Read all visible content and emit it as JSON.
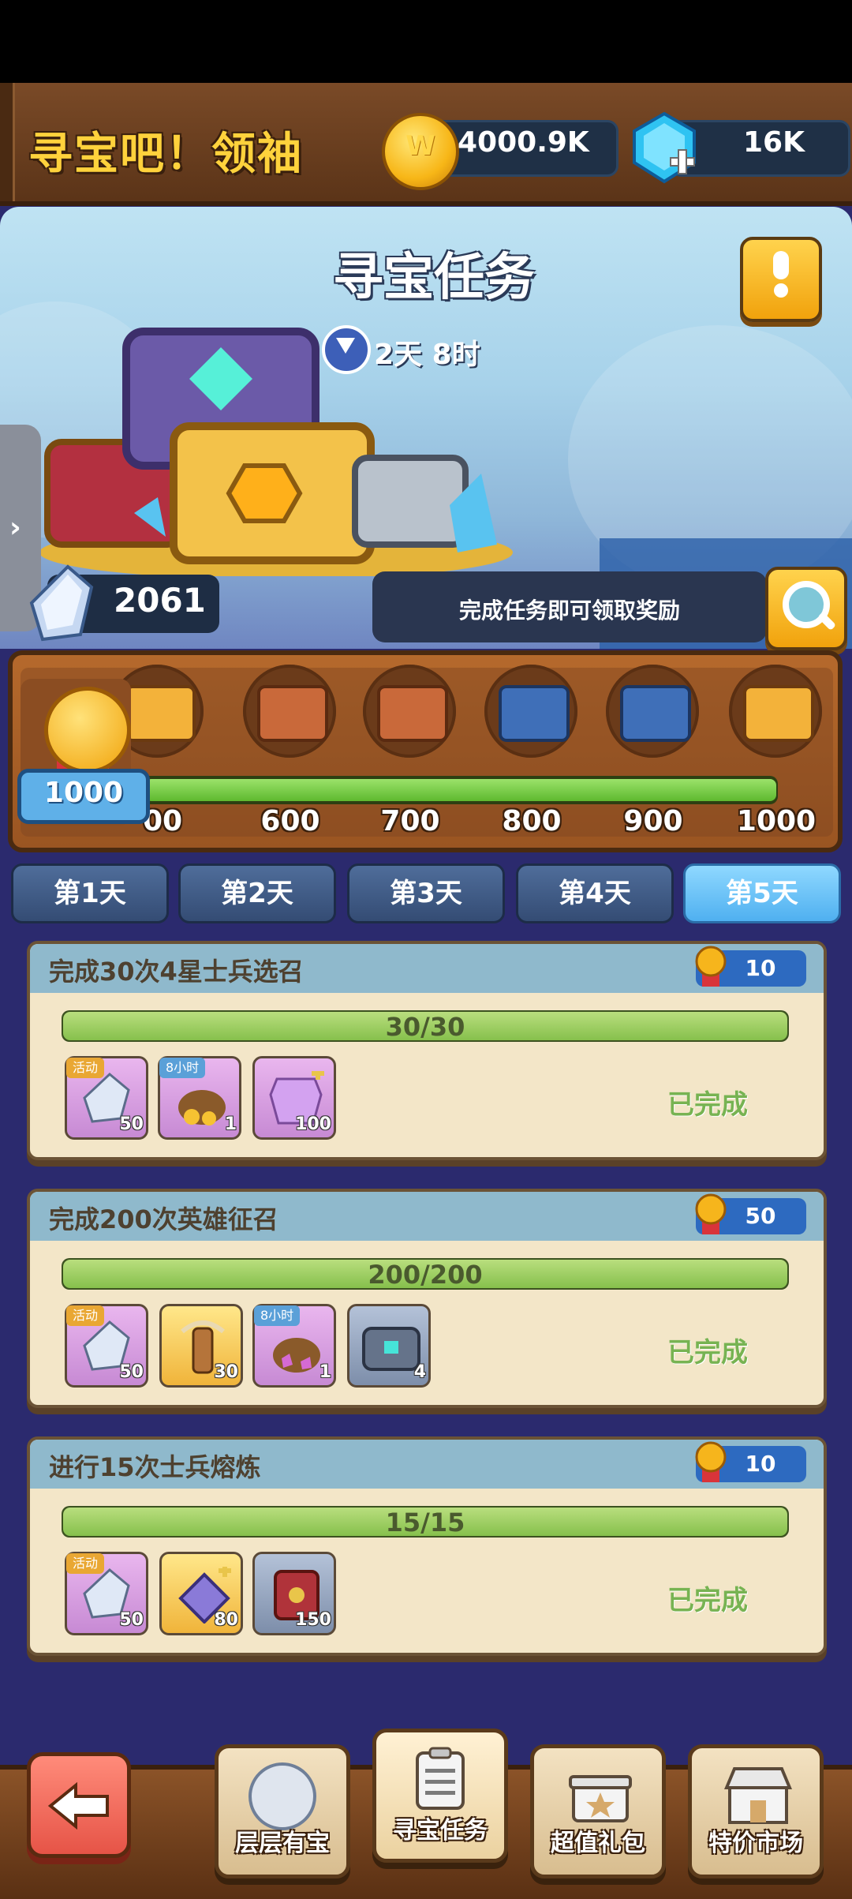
{
  "header": {
    "title": "寻宝吧！领袖",
    "coins": "4000.9K",
    "gems": "16K"
  },
  "hero": {
    "heading": "寻宝任务",
    "timer": "2天 8时",
    "crystal_count": "2061",
    "hint": "完成任务即可领取奖励"
  },
  "progress": {
    "current_score": "1000",
    "milestones": [
      "500",
      "600",
      "700",
      "800",
      "900",
      "1000"
    ],
    "visible_first_label": "00",
    "fill_fraction": 1.0
  },
  "days": {
    "tabs": [
      "第1天",
      "第2天",
      "第3天",
      "第4天",
      "第5天"
    ],
    "active_index": 4
  },
  "tasks": [
    {
      "title": "完成30次4星士兵选召",
      "points": "10",
      "progress_text": "30/30",
      "progress_fraction": 1.0,
      "status": "已完成",
      "rewards": [
        {
          "icon": "crystal-icon",
          "count": "50",
          "tag": "活动"
        },
        {
          "icon": "gold-sack-icon",
          "count": "1",
          "tag": "8小时"
        },
        {
          "icon": "armor-shard-icon",
          "count": "100",
          "tag": ""
        }
      ]
    },
    {
      "title": "完成200次英雄征召",
      "points": "50",
      "progress_text": "200/200",
      "progress_fraction": 1.0,
      "status": "已完成",
      "rewards": [
        {
          "icon": "crystal-icon",
          "count": "50",
          "tag": "活动"
        },
        {
          "icon": "totem-icon",
          "count": "30",
          "tag": ""
        },
        {
          "icon": "gem-sack-icon",
          "count": "1",
          "tag": "8小时"
        },
        {
          "icon": "chest-icon",
          "count": "4",
          "tag": ""
        }
      ]
    },
    {
      "title": "进行15次士兵熔炼",
      "points": "10",
      "progress_text": "15/15",
      "progress_fraction": 1.0,
      "status": "已完成",
      "rewards": [
        {
          "icon": "crystal-icon",
          "count": "50",
          "tag": "活动"
        },
        {
          "icon": "scroll-shard-icon",
          "count": "80",
          "tag": ""
        },
        {
          "icon": "book-icon",
          "count": "150",
          "tag": ""
        }
      ]
    }
  ],
  "bottom_nav": {
    "items": [
      "层层有宝",
      "寻宝任务",
      "超值礼包",
      "特价市场"
    ],
    "active_index": 1
  },
  "colors": {
    "accent_gold": "#ffd23c",
    "progress_green": "#86c04c",
    "active_tab_blue": "#4fb0f0",
    "done_green": "#77b352"
  }
}
